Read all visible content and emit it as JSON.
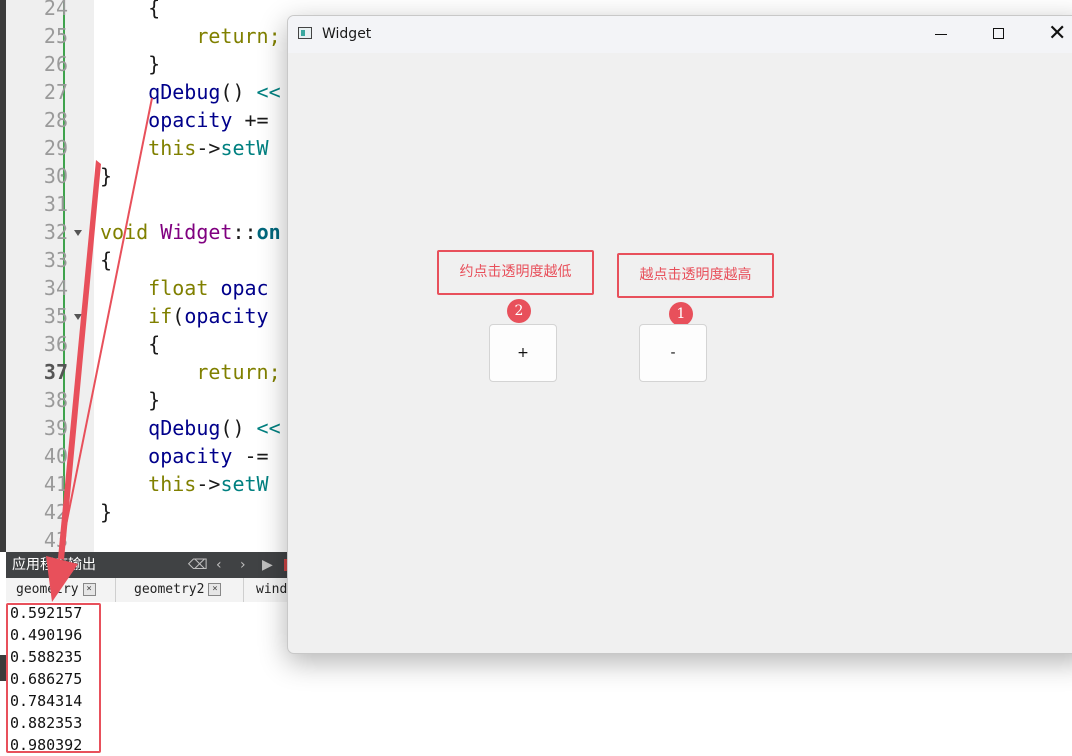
{
  "editor": {
    "lines": [
      {
        "no": "24",
        "tokens": [
          {
            "t": "{",
            "c": "tk-op"
          }
        ],
        "indent": "    "
      },
      {
        "no": "25",
        "tokens": [
          {
            "t": "return;",
            "c": "tk-kw"
          }
        ],
        "indent": "        "
      },
      {
        "no": "26",
        "tokens": [
          {
            "t": "}",
            "c": "tk-op"
          }
        ],
        "indent": "    "
      },
      {
        "no": "27",
        "tokens": [
          {
            "t": "qDebug",
            "c": "tk-fn"
          },
          {
            "t": "() ",
            "c": "tk-op"
          },
          {
            "t": "<<",
            "c": "tk-blue"
          }
        ],
        "indent": "    "
      },
      {
        "no": "28",
        "tokens": [
          {
            "t": "opacity",
            "c": "tk-fn"
          },
          {
            "t": " +=",
            "c": "tk-op"
          }
        ],
        "indent": "    "
      },
      {
        "no": "29",
        "tokens": [
          {
            "t": "this",
            "c": "tk-kw"
          },
          {
            "t": "->",
            "c": "tk-op"
          },
          {
            "t": "setW",
            "c": "tk-blue"
          }
        ],
        "indent": "    "
      },
      {
        "no": "30",
        "tokens": [
          {
            "t": "}",
            "c": "tk-op"
          }
        ],
        "indent": ""
      },
      {
        "no": "31",
        "tokens": [],
        "indent": ""
      },
      {
        "no": "32",
        "tokens": [
          {
            "t": "void",
            "c": "tk-kw"
          },
          {
            "t": " ",
            "c": "tk-op"
          },
          {
            "t": "Widget",
            "c": "tk-cls"
          },
          {
            "t": "::",
            "c": "tk-op"
          },
          {
            "t": "on",
            "c": "tk-bold"
          }
        ],
        "indent": "",
        "fold": true
      },
      {
        "no": "33",
        "tokens": [
          {
            "t": "{",
            "c": "tk-op"
          }
        ],
        "indent": ""
      },
      {
        "no": "34",
        "tokens": [
          {
            "t": "float",
            "c": "tk-kw"
          },
          {
            "t": " ",
            "c": "tk-op"
          },
          {
            "t": "opac",
            "c": "tk-fn"
          }
        ],
        "indent": "    "
      },
      {
        "no": "35",
        "tokens": [
          {
            "t": "if",
            "c": "tk-kw"
          },
          {
            "t": "(",
            "c": "tk-op"
          },
          {
            "t": "opacity",
            "c": "tk-fn"
          }
        ],
        "indent": "    ",
        "fold": true
      },
      {
        "no": "36",
        "tokens": [
          {
            "t": "{",
            "c": "tk-op"
          }
        ],
        "indent": "    "
      },
      {
        "no": "37",
        "tokens": [
          {
            "t": "return;",
            "c": "tk-kw"
          }
        ],
        "indent": "        ",
        "current": true
      },
      {
        "no": "38",
        "tokens": [
          {
            "t": "}",
            "c": "tk-op"
          }
        ],
        "indent": "    "
      },
      {
        "no": "39",
        "tokens": [
          {
            "t": "qDebug",
            "c": "tk-fn"
          },
          {
            "t": "() ",
            "c": "tk-op"
          },
          {
            "t": "<<",
            "c": "tk-blue"
          }
        ],
        "indent": "    "
      },
      {
        "no": "40",
        "tokens": [
          {
            "t": "opacity",
            "c": "tk-fn"
          },
          {
            "t": " -=",
            "c": "tk-op"
          }
        ],
        "indent": "    "
      },
      {
        "no": "41",
        "tokens": [
          {
            "t": "this",
            "c": "tk-kw"
          },
          {
            "t": "->",
            "c": "tk-op"
          },
          {
            "t": "setW",
            "c": "tk-blue"
          }
        ],
        "indent": "    "
      },
      {
        "no": "42",
        "tokens": [
          {
            "t": "}",
            "c": "tk-op"
          }
        ],
        "indent": ""
      },
      {
        "no": "43",
        "tokens": [],
        "indent": ""
      }
    ]
  },
  "output": {
    "title": "应用程序输出",
    "toolbar_icons": [
      "broom-icon",
      "prev-icon",
      "next-icon",
      "run-icon",
      "stop-icon"
    ],
    "tabs": [
      {
        "label": "geometry",
        "close": "×"
      },
      {
        "label": "geometry2",
        "close": "×"
      },
      {
        "label": "wind"
      }
    ],
    "lines": [
      "0.592157",
      "0.490196",
      "0.588235",
      "0.686275",
      "0.784314",
      "0.882353",
      "0.980392"
    ]
  },
  "window": {
    "title": "Widget",
    "min_label": "",
    "close_label": "✕",
    "plus_button": "+",
    "minus_button": "-",
    "callout_left": "约点击透明度越低",
    "callout_right": "越点击透明度越高",
    "badge_left": "2",
    "badge_right": "1"
  },
  "colors": {
    "annotation": "#e8505b",
    "change_bar": "#3fa34d"
  }
}
